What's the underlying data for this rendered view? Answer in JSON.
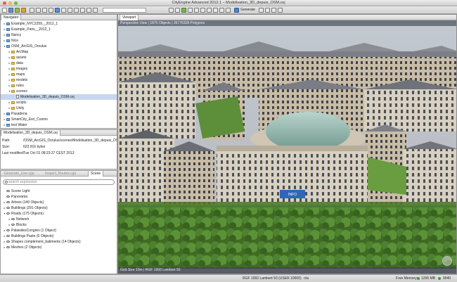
{
  "window": {
    "title": "CityEngine Advanced 2012.1 – Modelisation_3D_depuis_OSM.cej"
  },
  "colors": {
    "close": "#ee5c55",
    "minimize": "#f2bb3c",
    "zoom": "#5fc045",
    "selection": "#c6d7ef",
    "folder": "#e3c15a"
  },
  "toolbar": {
    "generate_label": "Generate"
  },
  "navigator": {
    "tab_label": "Navigator",
    "items": [
      {
        "label": "Example_NYC2259__2012_1",
        "indent": 0,
        "kind": "project",
        "arrow": "▸"
      },
      {
        "label": "Example_Paris__2012_1",
        "indent": 0,
        "kind": "project",
        "arrow": "▸"
      },
      {
        "label": "Nancy",
        "indent": 0,
        "kind": "project",
        "arrow": "▸"
      },
      {
        "label": "Nice",
        "indent": 0,
        "kind": "project",
        "arrow": "▸"
      },
      {
        "label": "OSM_ArcGIS_Orzulus",
        "indent": 0,
        "kind": "project",
        "arrow": "▾"
      },
      {
        "label": "ArcMap",
        "indent": 1,
        "kind": "folder",
        "arrow": "▸"
      },
      {
        "label": "assets",
        "indent": 1,
        "kind": "folder",
        "arrow": "▸"
      },
      {
        "label": "data",
        "indent": 1,
        "kind": "folder",
        "arrow": "▸"
      },
      {
        "label": "images",
        "indent": 1,
        "kind": "folder",
        "arrow": "▸"
      },
      {
        "label": "maps",
        "indent": 1,
        "kind": "folder",
        "arrow": "▸"
      },
      {
        "label": "models",
        "indent": 1,
        "kind": "folder",
        "arrow": "▸"
      },
      {
        "label": "rules",
        "indent": 1,
        "kind": "folder",
        "arrow": "▸"
      },
      {
        "label": "scenes",
        "indent": 1,
        "kind": "folder",
        "arrow": "▾"
      },
      {
        "label": "Modelisation_3D_depuis_OSM.cej",
        "indent": 2,
        "kind": "file",
        "arrow": "",
        "selected": true
      },
      {
        "label": "scripts",
        "indent": 1,
        "kind": "folder",
        "arrow": "▸"
      },
      {
        "label": "Unity",
        "indent": 1,
        "kind": "folder",
        "arrow": "▸"
      },
      {
        "label": "Pasadena",
        "indent": 0,
        "kind": "project",
        "arrow": "▸"
      },
      {
        "label": "SmartCity_Esri_Cosmo",
        "indent": 0,
        "kind": "project",
        "arrow": "▸"
      },
      {
        "label": "test Water",
        "indent": 0,
        "kind": "project",
        "arrow": "▸"
      },
      {
        "label": "Versailles_Chartier",
        "indent": 0,
        "kind": "project",
        "arrow": "▸"
      }
    ]
  },
  "properties": {
    "tab_label": "Modelisation_3D_depuis_OSM.cej",
    "rows": [
      {
        "key": "Path:",
        "value": "/OSM_ArcGIS_Orzulus/scenes/Modelisation_3D_depuis_OSM.cej"
      },
      {
        "key": "Size:",
        "value": "623 916 bytes"
      },
      {
        "key": "Last modified:",
        "value": "Tue Oct 01 08:23:27 CEST 2013"
      }
    ]
  },
  "scene_panel": {
    "tabs": [
      "Generate_Line.cga",
      "Inspect_Routes.cga",
      "Scene"
    ],
    "search_placeholder": "search expression",
    "items": [
      {
        "label": "Scene Light",
        "indent": 0,
        "arrow": ""
      },
      {
        "label": "Panorama",
        "indent": 0,
        "arrow": ""
      },
      {
        "label": "Arbres (140 Objects)",
        "indent": 0,
        "arrow": "▸"
      },
      {
        "label": "Buildings (291 Objects)",
        "indent": 0,
        "arrow": "▸"
      },
      {
        "label": "Roads (175 Objects)",
        "indent": 0,
        "arrow": "▾"
      },
      {
        "label": "Network",
        "indent": 1,
        "arrow": "▸"
      },
      {
        "label": "Blocks",
        "indent": 1,
        "arrow": "▸"
      },
      {
        "label": "PalaisdesCongres (1 Object)",
        "indent": 0,
        "arrow": "▸"
      },
      {
        "label": "Buildings Paste (0 Objects)",
        "indent": 0,
        "arrow": "▸"
      },
      {
        "label": "Shapes complement_batiments (14 Objects)",
        "indent": 0,
        "arrow": "▸"
      },
      {
        "label": "Meshes (2 Objects)",
        "indent": 0,
        "arrow": "▸"
      }
    ]
  },
  "viewport": {
    "tab_label": "Viewport",
    "info": "Perspective View  |  1875 Objects  |  36776328 Polygons",
    "footer": "Grid Size 10m  |  RGF 1993 Lambert 93",
    "sign_text": "INFO"
  },
  "status": {
    "crs": "RGF 1993 Lambert 93 (USER 10000)",
    "ellipsis": "n/a",
    "free_memory_label": "Free Memory:",
    "mem_a": "1296 MB",
    "mem_b": "9040"
  }
}
